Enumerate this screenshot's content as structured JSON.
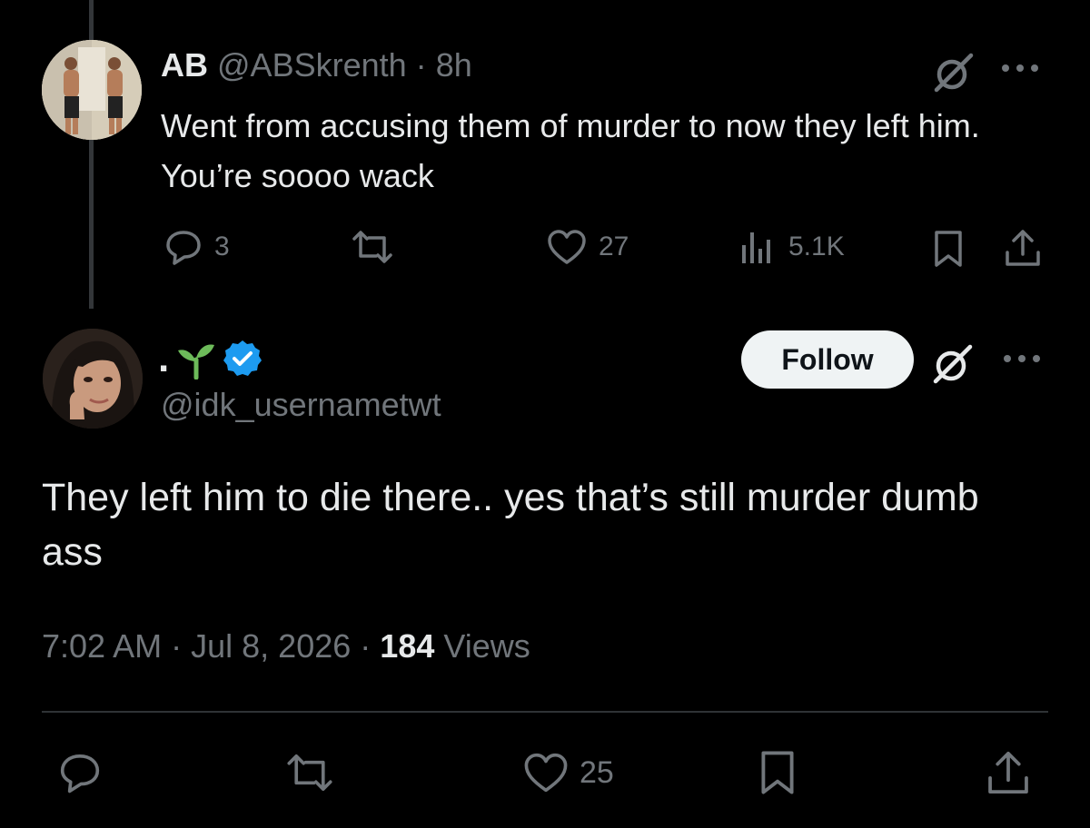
{
  "reply_tweet": {
    "display_name": "AB",
    "handle": "@ABSkrenth",
    "separator": "·",
    "time_ago": "8h",
    "text": "Went from accusing them of murder to now they left him. You’re soooo wack",
    "actions": {
      "reply_count": "3",
      "repost_count": "",
      "like_count": "27",
      "views_count": "5.1K"
    }
  },
  "main_tweet": {
    "display_name": ".",
    "name_emoji_icon": "seedling-icon",
    "verified_icon": "verified-badge-icon",
    "handle": "@idk_usernametwt",
    "follow_label": "Follow",
    "text": "They left him to die there.. yes that’s still murder dumb ass",
    "timestamp_time": "7:02 AM",
    "separator": "·",
    "timestamp_date": "Jul 8, 2026",
    "views_count": "184",
    "views_label": "Views",
    "actions": {
      "like_count": "25"
    }
  },
  "colors": {
    "background": "#000000",
    "text_primary": "#e7e9ea",
    "text_muted": "#71767b",
    "verified_blue": "#1d9bf0",
    "seedling_green": "#6dbb5a",
    "follow_bg": "#eff3f4"
  }
}
